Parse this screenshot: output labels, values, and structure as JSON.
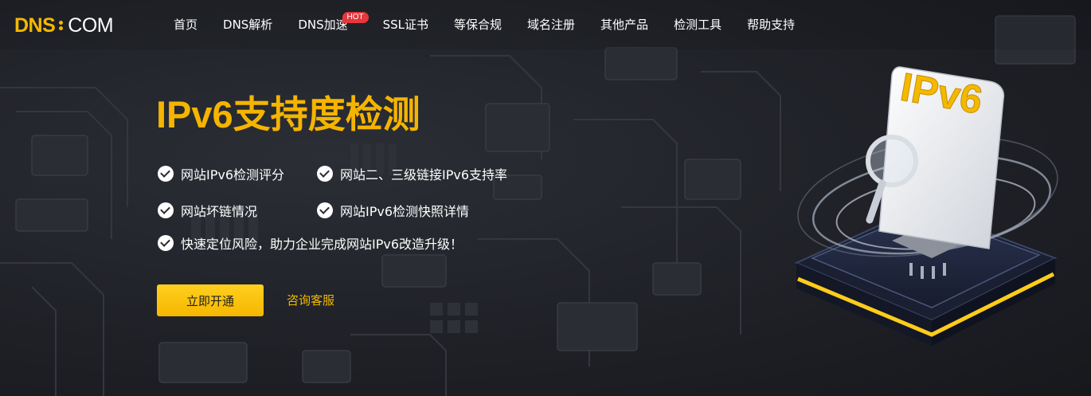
{
  "brand": {
    "logo_dns": "DNS",
    "logo_com": "COM"
  },
  "nav": {
    "items": [
      {
        "label": "首页"
      },
      {
        "label": "DNS解析"
      },
      {
        "label": "DNS加速",
        "badge": "HOT"
      },
      {
        "label": "SSL证书"
      },
      {
        "label": "等保合规"
      },
      {
        "label": "域名注册"
      },
      {
        "label": "其他产品"
      },
      {
        "label": "检测工具"
      },
      {
        "label": "帮助支持"
      }
    ]
  },
  "hero": {
    "title": "IPv6支持度检测",
    "features": [
      "网站IPv6检测评分",
      "网站二、三级链接IPv6支持率",
      "网站坏链情况",
      "网站IPv6检测快照详情",
      "快速定位风险，助力企业完成网站IPv6改造升级！"
    ],
    "primary_button": "立即开通",
    "secondary_link": "咨询客服",
    "illustration_label": "IPv6"
  },
  "colors": {
    "accent": "#f5b800",
    "background": "#1d1f24",
    "hot_badge": "#e5373d"
  }
}
